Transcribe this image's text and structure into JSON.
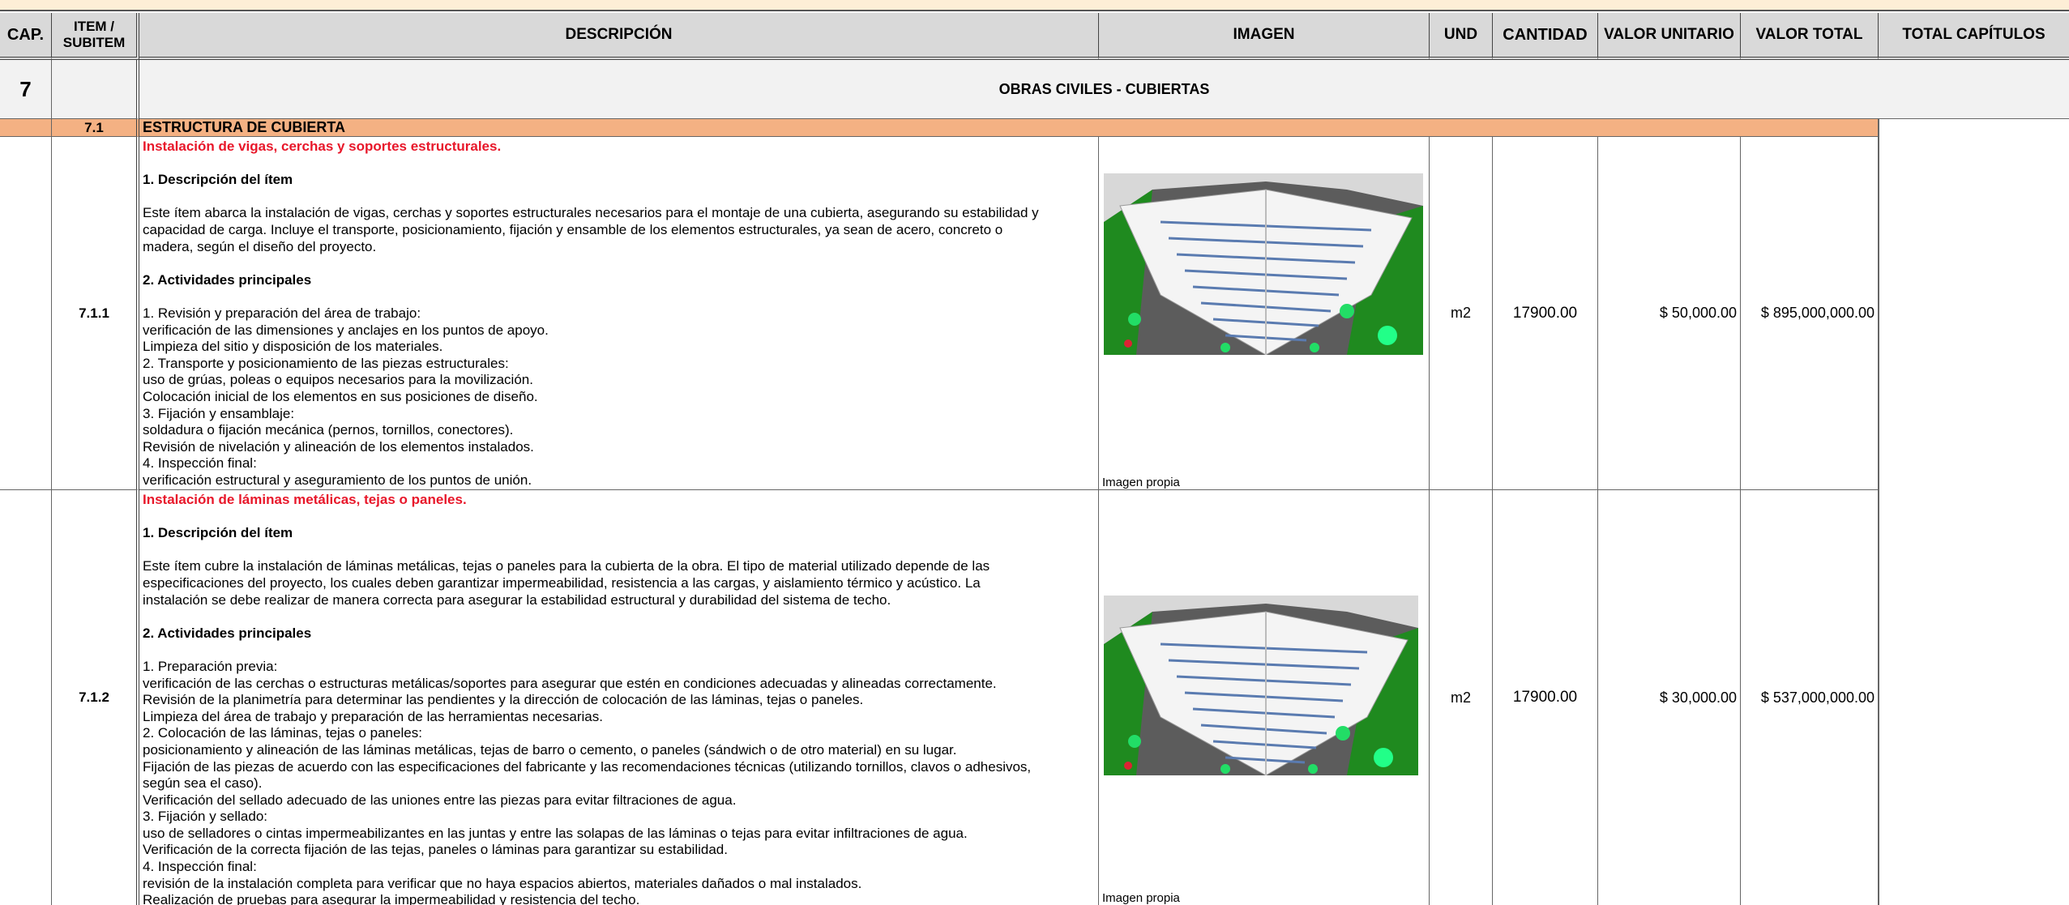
{
  "headers": {
    "cap": "CAP.",
    "item": "ITEM /\nSUBITEM",
    "descripcion": "DESCRIPCIÓN",
    "imagen": "IMAGEN",
    "und": "UND",
    "cantidad": "CANTIDAD",
    "valor_unitario": "VALOR UNITARIO",
    "valor_total": "VALOR TOTAL",
    "total_capitulos": "TOTAL CAPÍTULOS"
  },
  "chapter": {
    "number": "7",
    "title": "OBRAS CIVILES - CUBIERTAS"
  },
  "section": {
    "number": "7.1",
    "title": "ESTRUCTURA DE CUBIERTA"
  },
  "items": [
    {
      "id": "7.1.1",
      "title": "Instalación de vigas, cerchas y soportes estructurales.",
      "lines": [
        {
          "t": ""
        },
        {
          "t": "1. Descripción del ítem",
          "b": true
        },
        {
          "t": ""
        },
        {
          "t": "Este ítem abarca la instalación de vigas, cerchas y soportes estructurales necesarios para el montaje de una cubierta, asegurando su estabilidad y"
        },
        {
          "t": "capacidad de carga. Incluye el transporte, posicionamiento, fijación y ensamble de los elementos estructurales, ya sean de acero, concreto o"
        },
        {
          "t": "madera, según el diseño del proyecto."
        },
        {
          "t": ""
        },
        {
          "t": "2. Actividades principales",
          "b": true
        },
        {
          "t": ""
        },
        {
          "t": "1. Revisión y preparación del área de trabajo:"
        },
        {
          "t": "verificación de las dimensiones y anclajes en los puntos de apoyo."
        },
        {
          "t": "Limpieza del sitio y disposición de los materiales."
        },
        {
          "t": "2. Transporte y posicionamiento de las piezas estructurales:"
        },
        {
          "t": "uso de grúas, poleas o equipos necesarios para la movilización."
        },
        {
          "t": "Colocación inicial de los elementos en sus posiciones de diseño."
        },
        {
          "t": "3. Fijación y ensamblaje:"
        },
        {
          "t": "soldadura o fijación mecánica (pernos, tornillos, conectores)."
        },
        {
          "t": "Revisión de nivelación y alineación de los elementos instalados."
        },
        {
          "t": "4. Inspección final:"
        },
        {
          "t": "verificación estructural y aseguramiento de los puntos de unión."
        }
      ],
      "image_caption": "Imagen propia",
      "und": "m2",
      "cantidad": "17900.00",
      "valor_unitario": "$ 50,000.00",
      "valor_total": "$ 895,000,000.00"
    },
    {
      "id": "7.1.2",
      "title": "Instalación de láminas metálicas, tejas o paneles.",
      "lines": [
        {
          "t": ""
        },
        {
          "t": "1. Descripción del ítem",
          "b": true
        },
        {
          "t": ""
        },
        {
          "t": "Este ítem cubre la instalación de láminas metálicas, tejas o paneles para la cubierta de la obra. El tipo de material utilizado depende de las"
        },
        {
          "t": "especificaciones del proyecto, los cuales deben garantizar impermeabilidad, resistencia a las cargas, y aislamiento térmico y acústico. La"
        },
        {
          "t": "instalación se debe realizar de manera correcta para asegurar la estabilidad estructural y durabilidad del sistema de techo."
        },
        {
          "t": ""
        },
        {
          "t": "2. Actividades principales",
          "b": true
        },
        {
          "t": ""
        },
        {
          "t": "1. Preparación previa:"
        },
        {
          "t": "verificación de las cerchas o estructuras metálicas/soportes para asegurar que estén en condiciones adecuadas y alineadas correctamente."
        },
        {
          "t": "Revisión de la planimetría para determinar las pendientes y la dirección de colocación de las láminas, tejas o paneles."
        },
        {
          "t": "Limpieza del área de trabajo y preparación de las herramientas necesarias."
        },
        {
          "t": "2. Colocación de las láminas, tejas o paneles:"
        },
        {
          "t": "posicionamiento y alineación de las láminas metálicas, tejas de barro o cemento, o paneles (sándwich o de otro material) en su lugar."
        },
        {
          "t": "Fijación de las piezas de acuerdo con las especificaciones del fabricante y las recomendaciones técnicas (utilizando tornillos, clavos o adhesivos,"
        },
        {
          "t": "según sea el caso)."
        },
        {
          "t": "Verificación del sellado adecuado de las uniones entre las piezas para evitar filtraciones de agua."
        },
        {
          "t": "3. Fijación y sellado:"
        },
        {
          "t": "uso de selladores o cintas impermeabilizantes en las juntas y entre las solapas de las láminas o tejas para evitar infiltraciones de agua."
        },
        {
          "t": "Verificación de la correcta fijación de las tejas, paneles o láminas para garantizar su estabilidad."
        },
        {
          "t": "4. Inspección final:"
        },
        {
          "t": "revisión de la instalación completa para verificar que no haya espacios abiertos, materiales dañados o mal instalados."
        },
        {
          "t": "Realización de pruebas para asegurar la impermeabilidad y resistencia del techo."
        }
      ],
      "image_caption": "Imagen propia",
      "und": "m2",
      "cantidad": "17900.00",
      "valor_unitario": "$ 30,000.00",
      "valor_total": "$ 537,000,000.00"
    }
  ]
}
